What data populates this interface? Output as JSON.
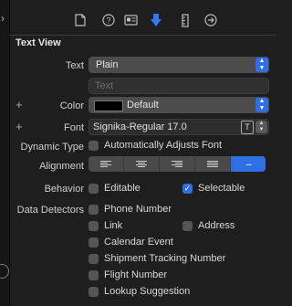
{
  "section_title": "Text View",
  "text": {
    "label": "Text",
    "value": "Plain",
    "placeholder": "Text"
  },
  "color": {
    "label": "Color",
    "value": "Default",
    "swatch": "#000000"
  },
  "font": {
    "label": "Font",
    "value": "Signika-Regular 17.0",
    "t_button": "T"
  },
  "dynamic_type": {
    "label": "Dynamic Type",
    "option": "Automatically Adjusts Font",
    "checked": false
  },
  "alignment": {
    "label": "Alignment",
    "options": [
      "left",
      "center",
      "right",
      "justified",
      "natural"
    ],
    "selected": "natural",
    "natural_glyph": "---"
  },
  "behavior": {
    "label": "Behavior",
    "editable": "Editable",
    "selectable": "Selectable",
    "editable_checked": false,
    "selectable_checked": true
  },
  "data_detectors": {
    "label": "Data Detectors",
    "phone": "Phone Number",
    "link": "Link",
    "address": "Address",
    "calendar": "Calendar Event",
    "shipment": "Shipment Tracking Number",
    "flight": "Flight Number",
    "lookup": "Lookup Suggestion"
  },
  "icons": [
    "file-icon",
    "help-icon",
    "identity-icon",
    "attributes-icon",
    "size-icon",
    "connections-icon"
  ],
  "accent_color": "#2f6ee3",
  "checkmark": "✓"
}
